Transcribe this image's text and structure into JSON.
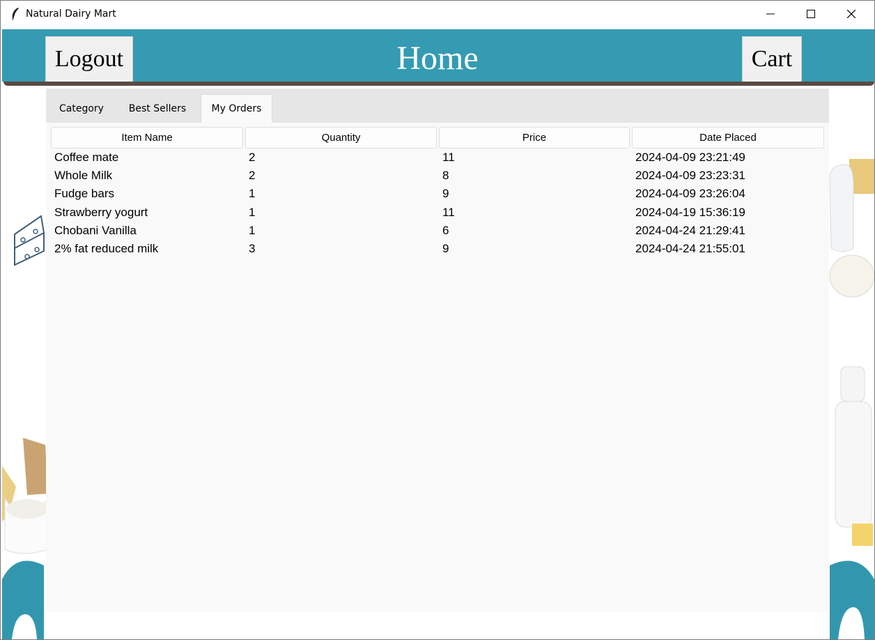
{
  "window": {
    "title": "Natural Dairy Mart"
  },
  "header": {
    "logout_label": "Logout",
    "title": "Home",
    "cart_label": "Cart"
  },
  "tabs": [
    {
      "label": "Category"
    },
    {
      "label": "Best Sellers"
    },
    {
      "label": "My Orders"
    }
  ],
  "active_tab": "My Orders",
  "orders": {
    "columns": [
      "Item Name",
      "Quantity",
      "Price",
      "Date Placed"
    ],
    "rows": [
      [
        "Coffee mate",
        "2",
        "11",
        "2024-04-09 23:21:49"
      ],
      [
        "Whole Milk",
        "2",
        "8",
        "2024-04-09 23:23:31"
      ],
      [
        "Fudge bars",
        "1",
        "9",
        "2024-04-09 23:26:04"
      ],
      [
        "Strawberry yogurt",
        "1",
        "11",
        "2024-04-19 15:36:19"
      ],
      [
        "Chobani Vanilla",
        "1",
        "6",
        "2024-04-24 21:29:41"
      ],
      [
        "2% fat reduced milk",
        "3",
        "9",
        "2024-04-24 21:55:01"
      ]
    ]
  },
  "colors": {
    "header": "#349bb2",
    "panel": "#f9f9f9",
    "tabbar": "#e6e6e6"
  }
}
